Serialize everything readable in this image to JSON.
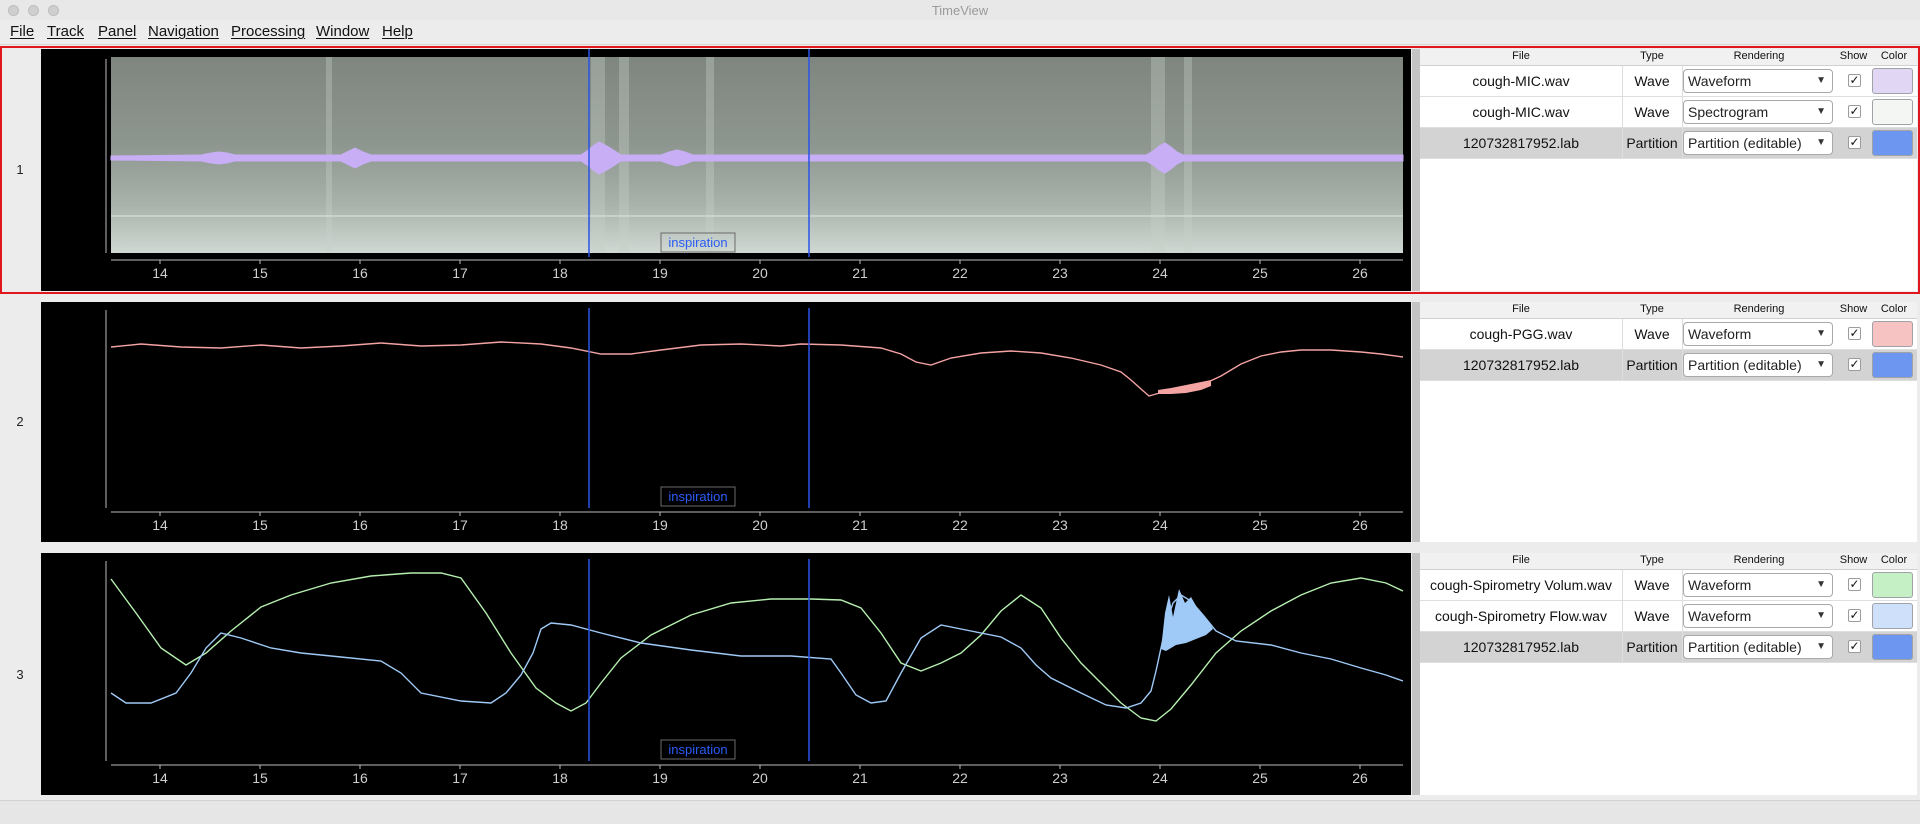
{
  "window": {
    "title": "TimeView"
  },
  "menu": [
    "File",
    "Track",
    "Panel",
    "Navigation",
    "Processing",
    "Window",
    "Help"
  ],
  "table_headers": {
    "file": "File",
    "type": "Type",
    "rendering": "Rendering",
    "show": "Show",
    "color": "Color"
  },
  "axis": {
    "ticks": [
      "14",
      "15",
      "16",
      "17",
      "18",
      "19",
      "20",
      "21",
      "22",
      "23",
      "24",
      "25",
      "26"
    ]
  },
  "panels": [
    {
      "number": "1",
      "label": "inspiration",
      "tracks": [
        {
          "file": "cough-MIC.wav",
          "type": "Wave",
          "rendering": "Waveform",
          "show": "✓",
          "color": "#e2d6f5"
        },
        {
          "file": "cough-MIC.wav",
          "type": "Wave",
          "rendering": "Spectrogram",
          "show": "✓",
          "color": "#f3f6f3"
        },
        {
          "file": "120732817952.lab",
          "type": "Partition",
          "rendering": "Partition (editable)",
          "show": "✓",
          "color": "#6c96f0"
        }
      ]
    },
    {
      "number": "2",
      "label": "inspiration",
      "tracks": [
        {
          "file": "cough-PGG.wav",
          "type": "Wave",
          "rendering": "Waveform",
          "show": "✓",
          "color": "#f7c2c2"
        },
        {
          "file": "120732817952.lab",
          "type": "Partition",
          "rendering": "Partition (editable)",
          "show": "✓",
          "color": "#6c96f0"
        }
      ]
    },
    {
      "number": "3",
      "label": "inspiration",
      "tracks": [
        {
          "file": "cough-Spirometry Volum.wav",
          "type": "Wave",
          "rendering": "Waveform",
          "show": "✓",
          "color": "#c5f0c5"
        },
        {
          "file": "cough-Spirometry Flow.wav",
          "type": "Wave",
          "rendering": "Waveform",
          "show": "✓",
          "color": "#cfe0fa"
        },
        {
          "file": "120732817952.lab",
          "type": "Partition",
          "rendering": "Partition (editable)",
          "show": "✓",
          "color": "#6c96f0"
        }
      ]
    }
  ]
}
